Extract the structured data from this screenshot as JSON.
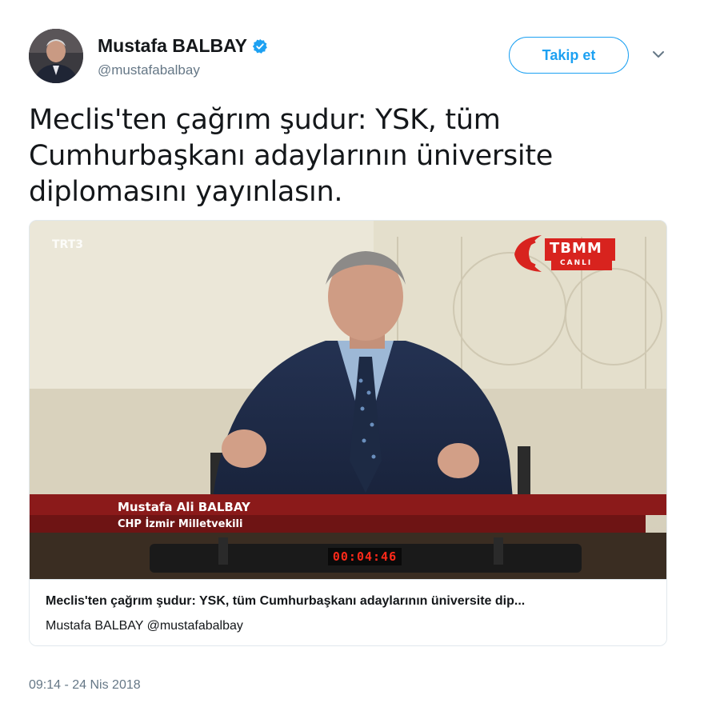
{
  "user": {
    "display_name": "Mustafa BALBAY",
    "handle": "@mustafabalbay",
    "verified": true,
    "avatar_icon": "profile-photo"
  },
  "actions": {
    "follow_label": "Takip et",
    "more_icon": "chevron-down-icon"
  },
  "tweet": {
    "text": "Meclis'ten çağrım şudur: YSK, tüm Cumhurbaşkanı adaylarının üniversite diplomasını yayınlasın."
  },
  "card": {
    "video": {
      "channel_bug": "TRT3",
      "broadcaster_logo": "TBMM",
      "broadcaster_sub": "CANLI",
      "lower_third_name": "Mustafa Ali BALBAY",
      "lower_third_role": "CHP İzmir Milletvekili",
      "timer": "00:04:46"
    },
    "title": "Meclis'ten çağrım şudur: YSK, tüm Cumhurbaşkanı adaylarının üniversite dip...",
    "source": "Mustafa BALBAY @mustafabalbay"
  },
  "timestamp": "09:14 - 24 Nis 2018",
  "colors": {
    "accent": "#1da1f2",
    "text": "#14171a",
    "secondary": "#657786",
    "lower_third_red": "#8b1a1a",
    "tbmm_red": "#d8231e"
  }
}
